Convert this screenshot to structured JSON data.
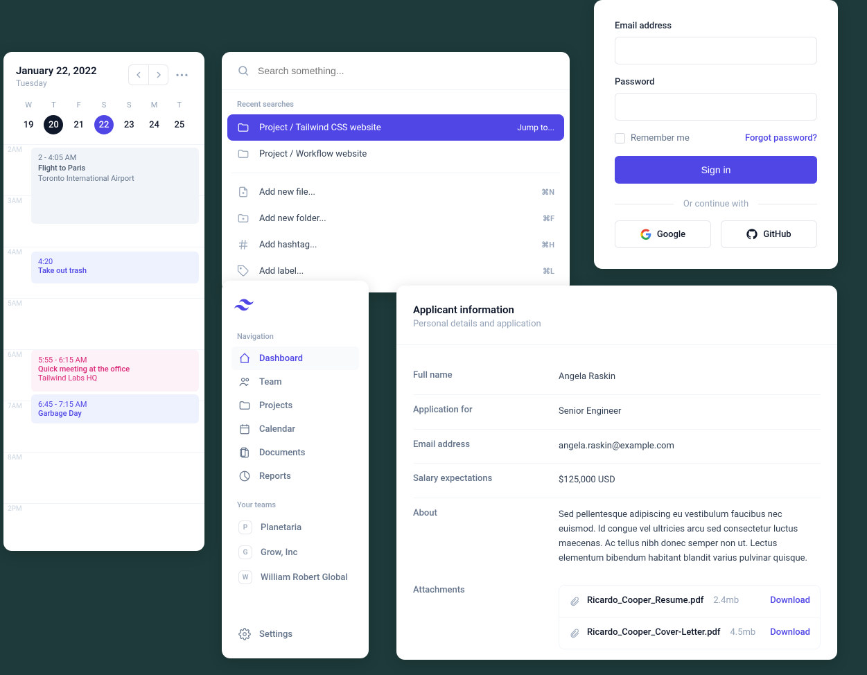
{
  "calendar": {
    "date": "January 22, 2022",
    "weekday": "Tuesday",
    "days": [
      {
        "label": "W",
        "num": "19"
      },
      {
        "label": "T",
        "num": "20",
        "dark": true
      },
      {
        "label": "F",
        "num": "21"
      },
      {
        "label": "S",
        "num": "22",
        "selected": true
      },
      {
        "label": "S",
        "num": "23"
      },
      {
        "label": "M",
        "num": "24"
      },
      {
        "label": "T",
        "num": "25"
      }
    ],
    "hours": [
      "2AM",
      "3AM",
      "4AM",
      "5AM",
      "6AM",
      "7AM",
      "8AM",
      "2PM"
    ],
    "events": [
      {
        "time": "2 - 4:05 AM",
        "title": "Flight to Paris",
        "sub": "Toronto International Airport",
        "type": "gray"
      },
      {
        "time": "4:20",
        "title": "Take out trash",
        "type": "indigo"
      },
      {
        "time": "5:55 - 6:15 AM",
        "title": "Quick meeting at the office",
        "sub": "Tailwind Labs HQ",
        "type": "pink"
      },
      {
        "time": "6:45 - 7:15 AM",
        "title": "Garbage Day",
        "type": "indigo"
      }
    ]
  },
  "palette": {
    "placeholder": "Search something...",
    "recentLabel": "Recent searches",
    "recent": [
      {
        "label": "Project / Tailwind CSS website",
        "jump": "Jump to...",
        "selected": true
      },
      {
        "label": "Project / Workflow website"
      }
    ],
    "actions": [
      {
        "label": "Add new file...",
        "shortcut": "⌘N",
        "icon": "file"
      },
      {
        "label": "Add new folder...",
        "shortcut": "⌘F",
        "icon": "folder-plus"
      },
      {
        "label": "Add hashtag...",
        "shortcut": "⌘H",
        "icon": "hash"
      },
      {
        "label": "Add label...",
        "shortcut": "⌘L",
        "icon": "tag"
      }
    ]
  },
  "login": {
    "emailLabel": "Email address",
    "passwordLabel": "Password",
    "rememberLabel": "Remember me",
    "forgotLabel": "Forgot password?",
    "signInLabel": "Sign in",
    "continueLabel": "Or continue with",
    "social": [
      {
        "name": "Google",
        "icon": "google"
      },
      {
        "name": "GitHub",
        "icon": "github"
      }
    ]
  },
  "sidebar": {
    "navLabel": "Navigation",
    "items": [
      {
        "label": "Dashboard",
        "icon": "home",
        "active": true
      },
      {
        "label": "Team",
        "icon": "users"
      },
      {
        "label": "Projects",
        "icon": "folder"
      },
      {
        "label": "Calendar",
        "icon": "calendar"
      },
      {
        "label": "Documents",
        "icon": "document"
      },
      {
        "label": "Reports",
        "icon": "chart"
      }
    ],
    "teamsLabel": "Your teams",
    "teams": [
      {
        "badge": "P",
        "label": "Planetaria"
      },
      {
        "badge": "G",
        "label": "Grow, Inc"
      },
      {
        "badge": "W",
        "label": "William Robert Global"
      }
    ],
    "settingsLabel": "Settings"
  },
  "details": {
    "title": "Applicant information",
    "subtitle": "Personal details and application",
    "rows": [
      {
        "k": "Full name",
        "v": "Angela Raskin"
      },
      {
        "k": "Application for",
        "v": "Senior Engineer"
      },
      {
        "k": "Email address",
        "v": "angela.raskin@example.com"
      },
      {
        "k": "Salary expectations",
        "v": "$125,000 USD"
      },
      {
        "k": "About",
        "v": "Sed pellentesque adipiscing eu vestibulum faucibus nec euismod. Id congue vel ultricies arcu sed consectetur luctus maecenas. Ac tellus nibh donec semper non ut. Lectus elementum bibendum habitant blandit varius pulvinar quisque."
      }
    ],
    "attachLabel": "Attachments",
    "attachments": [
      {
        "name": "Ricardo_Cooper_Resume.pdf",
        "size": "2.4mb",
        "action": "Download"
      },
      {
        "name": "Ricardo_Cooper_Cover-Letter.pdf",
        "size": "4.5mb",
        "action": "Download"
      }
    ]
  }
}
